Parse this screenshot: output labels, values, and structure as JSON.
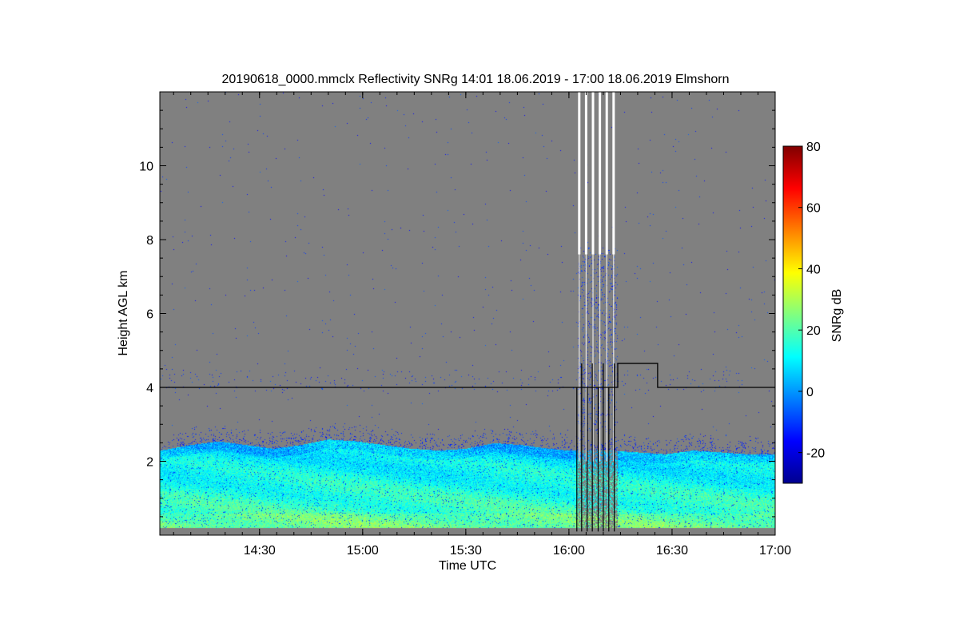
{
  "chart_data": {
    "type": "heatmap",
    "title": "20190618_0000.mmclx Reflectivity SNRg   14:01 18.06.2019 - 17:00 18.06.2019 Elmshorn",
    "xlabel": "Time UTC",
    "ylabel": "Height AGL km",
    "colorbar_label": "SNRg dB",
    "x_range_minutes_utc": [
      841,
      1020
    ],
    "x_ticks": [
      {
        "minute": 870,
        "label": "14:30"
      },
      {
        "minute": 900,
        "label": "15:00"
      },
      {
        "minute": 930,
        "label": "15:30"
      },
      {
        "minute": 960,
        "label": "16:00"
      },
      {
        "minute": 990,
        "label": "16:30"
      },
      {
        "minute": 1020,
        "label": "17:00"
      }
    ],
    "ylim_km": [
      0,
      12
    ],
    "y_ticks": [
      {
        "value": 2,
        "label": "2"
      },
      {
        "value": 4,
        "label": "4"
      },
      {
        "value": 6,
        "label": "6"
      },
      {
        "value": 8,
        "label": "8"
      },
      {
        "value": 10,
        "label": "10"
      }
    ],
    "colorbar_range_db": [
      -30,
      80
    ],
    "colorbar_ticks": [
      {
        "value": -20,
        "label": "-20"
      },
      {
        "value": 0,
        "label": "0"
      },
      {
        "value": 20,
        "label": "20"
      },
      {
        "value": 40,
        "label": "40"
      },
      {
        "value": 60,
        "label": "60"
      },
      {
        "value": 80,
        "label": "80"
      }
    ],
    "background_color": "#808080",
    "colormap": "jet",
    "boundary_layer_top_km": [
      {
        "minute": 841,
        "value": 2.3
      },
      {
        "minute": 850,
        "value": 2.45
      },
      {
        "minute": 858,
        "value": 2.55
      },
      {
        "minute": 866,
        "value": 2.45
      },
      {
        "minute": 874,
        "value": 2.35
      },
      {
        "minute": 882,
        "value": 2.45
      },
      {
        "minute": 890,
        "value": 2.6
      },
      {
        "minute": 898,
        "value": 2.55
      },
      {
        "minute": 906,
        "value": 2.45
      },
      {
        "minute": 914,
        "value": 2.35
      },
      {
        "minute": 922,
        "value": 2.3
      },
      {
        "minute": 930,
        "value": 2.35
      },
      {
        "minute": 938,
        "value": 2.5
      },
      {
        "minute": 946,
        "value": 2.45
      },
      {
        "minute": 954,
        "value": 2.35
      },
      {
        "minute": 960,
        "value": 2.3
      },
      {
        "minute": 972,
        "value": 2.3
      },
      {
        "minute": 980,
        "value": 2.25
      },
      {
        "minute": 988,
        "value": 2.2
      },
      {
        "minute": 996,
        "value": 2.3
      },
      {
        "minute": 1004,
        "value": 2.25
      },
      {
        "minute": 1012,
        "value": 2.2
      },
      {
        "minute": 1020,
        "value": 2.2
      }
    ],
    "gap_minutes": [
      962.5,
      974
    ],
    "gap_white_stripe_minutes": [
      963,
      965,
      967,
      969,
      971,
      973
    ],
    "reference_line_km": [
      {
        "minute": 841,
        "value": 4.0
      },
      {
        "minute": 962,
        "value": 4.0
      },
      {
        "minute": 974.2,
        "value": 4.0
      },
      {
        "minute": 974.2,
        "value": 4.65
      },
      {
        "minute": 985.8,
        "value": 4.65
      },
      {
        "minute": 985.8,
        "value": 4.0
      },
      {
        "minute": 1020,
        "value": 4.0
      }
    ]
  },
  "colors": {
    "background_gray": "#808080",
    "reference_line": "#000000",
    "stripe_white": "#ffffff"
  }
}
